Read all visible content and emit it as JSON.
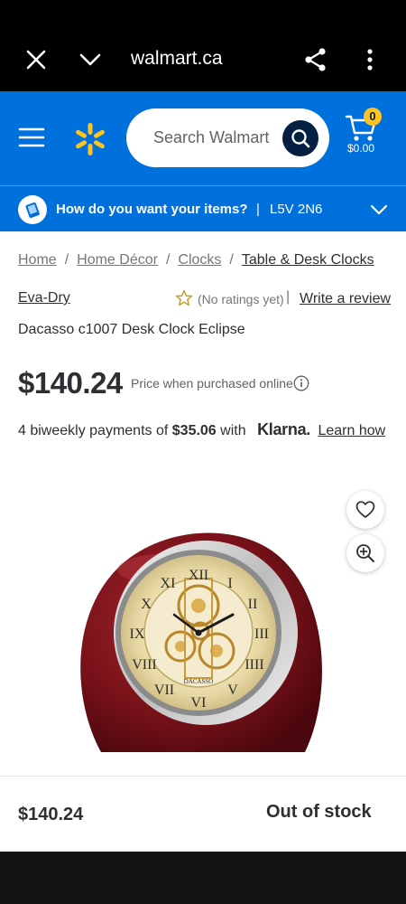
{
  "browser": {
    "url": "walmart.ca",
    "icons": [
      "close-icon",
      "chevron-down-icon",
      "share-icon",
      "more-vert-icon"
    ]
  },
  "header": {
    "search_placeholder": "Search Walmart",
    "cart_count": "0",
    "cart_total": "$0.00",
    "colors": {
      "brand_blue": "#0071dc",
      "spark_yellow": "#ffc220",
      "navy": "#041f41"
    }
  },
  "fulfillment": {
    "question": "How do you want your items?",
    "separator": "|",
    "postal_code": "L5V 2N6"
  },
  "breadcrumb": {
    "items": [
      "Home",
      "Home Décor",
      "Clocks",
      "Table & Desk Clocks"
    ],
    "separator": "/"
  },
  "product": {
    "brand": "Eva-Dry",
    "rating_text": "(No ratings yet)",
    "rating_separator": "|",
    "write_review": "Write a review",
    "title": "Dacasso c1007 Desk Clock Eclipse",
    "price": "$140.24",
    "price_note": "Price when purchased online",
    "installments_prefix": "4 biweekly payments of",
    "installment_amount": "$35.06",
    "installments_with": "with",
    "klarna_brand": "Klarna.",
    "learn_how": "Learn how",
    "clock_brand_text": "DACASSO"
  },
  "sticky_bar": {
    "price": "$140.24",
    "status": "Out of stock"
  }
}
